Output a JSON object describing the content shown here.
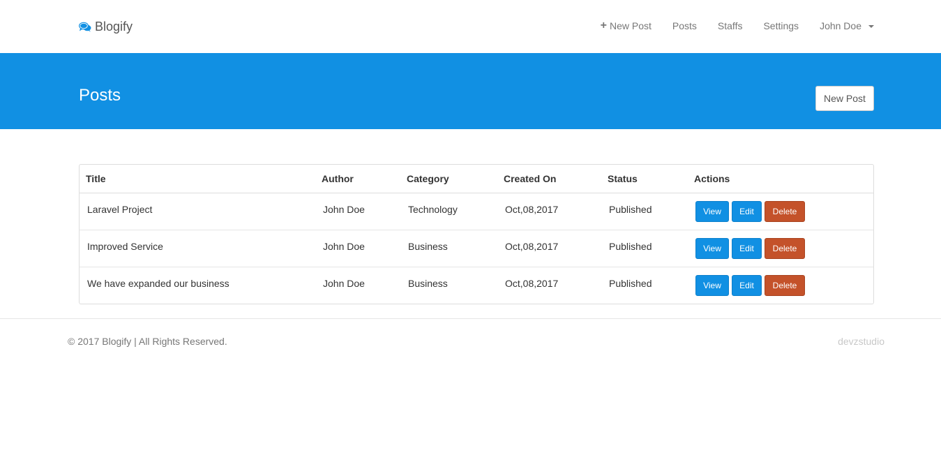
{
  "brand": {
    "name": "Blogify",
    "icon": "comments-icon"
  },
  "nav": {
    "new_post": "New Post",
    "posts": "Posts",
    "staffs": "Staffs",
    "settings": "Settings",
    "user": "John Doe"
  },
  "hero": {
    "title": "Posts",
    "button": "New Post"
  },
  "table": {
    "headers": [
      "Title",
      "Author",
      "Category",
      "Created On",
      "Status",
      "Actions"
    ],
    "rows": [
      {
        "title": "Laravel Project",
        "author": "John Doe",
        "category": "Technology",
        "created_on": "Oct,08,2017",
        "status": "Published"
      },
      {
        "title": "Improved Service",
        "author": "John Doe",
        "category": "Business",
        "created_on": "Oct,08,2017",
        "status": "Published"
      },
      {
        "title": "We have expanded our business",
        "author": "John Doe",
        "category": "Business",
        "created_on": "Oct,08,2017",
        "status": "Published"
      }
    ],
    "actions": {
      "view": "View",
      "edit": "Edit",
      "delete": "Delete"
    }
  },
  "footer": {
    "copyright": "© 2017 Blogify | All Rights Reserved.",
    "credit": "devzstudio"
  },
  "colors": {
    "primary": "#1190e3",
    "danger": "#c4522a",
    "text": "#333333",
    "muted": "#777777"
  }
}
